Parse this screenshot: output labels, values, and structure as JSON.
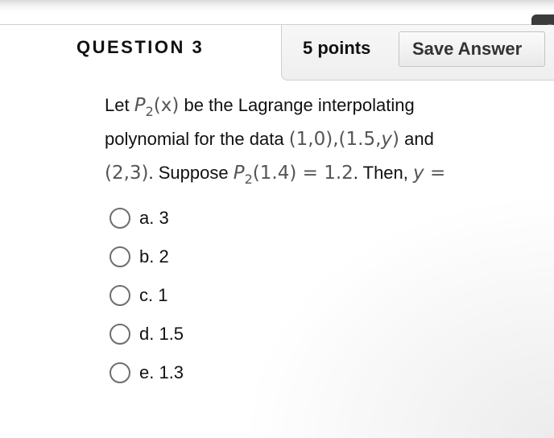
{
  "header": {
    "question_title": "QUESTION 3",
    "points": "5 points",
    "save_label": "Save Answer"
  },
  "question": {
    "t1": "Let",
    "p2_a": "P",
    "sub_a": "2",
    "x_arg": "(x)",
    "t2": "be the Lagrange interpolating",
    "t3": "polynomial for the data",
    "pt1": "(1,0),",
    "pt2": "(1.5,",
    "pt2_y": "y",
    "pt2_close": ")",
    "t4": "and",
    "pt3": "(2,3)",
    "t5": ". Suppose",
    "p2_b": "P",
    "sub_b": "2",
    "eval": "(1.4) = 1.2",
    "t6": ". Then,",
    "y_var": "y",
    "eq": "="
  },
  "options": [
    {
      "label": "a. 3"
    },
    {
      "label": "b. 2"
    },
    {
      "label": "c. 1"
    },
    {
      "label": "d. 1.5"
    },
    {
      "label": "e. 1.3"
    }
  ]
}
